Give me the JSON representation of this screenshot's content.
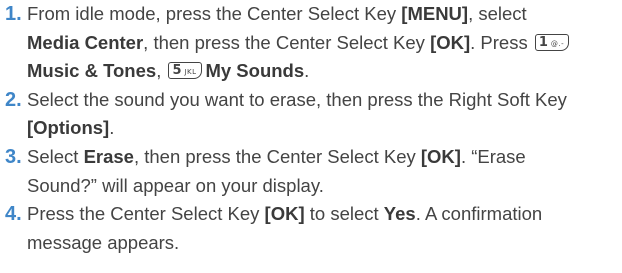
{
  "steps": [
    {
      "number": "1.",
      "seg": [
        "From idle mode, press the Center Select Key ",
        "[MENU]",
        ", select",
        "Media Center",
        ", then press the Center Select Key ",
        "[OK]",
        ". Press ",
        "Music & Tones",
        ", ",
        "My Sounds",
        "."
      ],
      "keys": [
        {
          "digit": "1",
          "letters": "@.-"
        },
        {
          "digit": "5",
          "letters": "JKL"
        }
      ]
    },
    {
      "number": "2.",
      "seg": [
        "Select the sound you want to erase, then press the Right Soft Key",
        "[Options]",
        "."
      ]
    },
    {
      "number": "3.",
      "seg": [
        "Select ",
        "Erase",
        ", then press the Center Select Key ",
        "[OK]",
        ". “Erase",
        "Sound?” will appear on your display."
      ]
    },
    {
      "number": "4.",
      "seg": [
        "Press the Center Select Key ",
        "[OK]",
        " to select ",
        "Yes",
        ". A confirmation",
        "message appears."
      ]
    }
  ]
}
